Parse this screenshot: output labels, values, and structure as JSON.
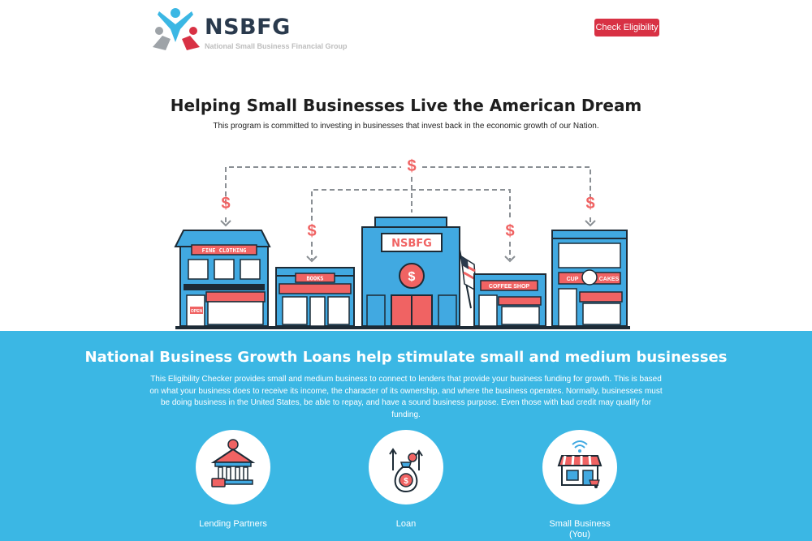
{
  "header": {
    "brand_name": "NSBFG",
    "brand_tagline": "National Small Business Financial Group",
    "cta_label": "Check Eligibility"
  },
  "hero": {
    "title": "Helping Small Businesses Live the American Dream",
    "subtitle": "This program is committed to investing in businesses that invest back in the economic growth of our Nation."
  },
  "illustration": {
    "dollar_sign": "$",
    "stores": {
      "fine_clothing": "FINE CLOTHING",
      "books": "BOOKS",
      "center_sign": "NSBFG",
      "coffee_shop": "COFFEE SHOP",
      "cupcakes_left": "CUP",
      "cupcakes_right": "CAKES",
      "open_sign": "OPEN"
    }
  },
  "info": {
    "title": "National Business Growth Loans help stimulate small and medium businesses",
    "body": "This Eligibility Checker provides small and medium business to connect to lenders that provide your business funding for growth. This is based on what your business does to receive its income, the character of its ownership, and where the business operates. Normally, businesses must be doing business in the United States, be able to repay, and have a sound business purpose. Even those with bad credit may qualify for funding."
  },
  "features": [
    {
      "label": "Lending Partners",
      "icon": "bank-icon"
    },
    {
      "label": "Loan",
      "icon": "money-bag-icon"
    },
    {
      "label": "Small Business\n(You)",
      "icon": "storefront-icon"
    }
  ],
  "colors": {
    "brand_dark": "#2a3a4d",
    "accent_red": "#d83144",
    "band_blue": "#3bb7e4",
    "store_blue": "#41a9e1",
    "store_red": "#f06363",
    "line_dark": "#1d2b36"
  }
}
